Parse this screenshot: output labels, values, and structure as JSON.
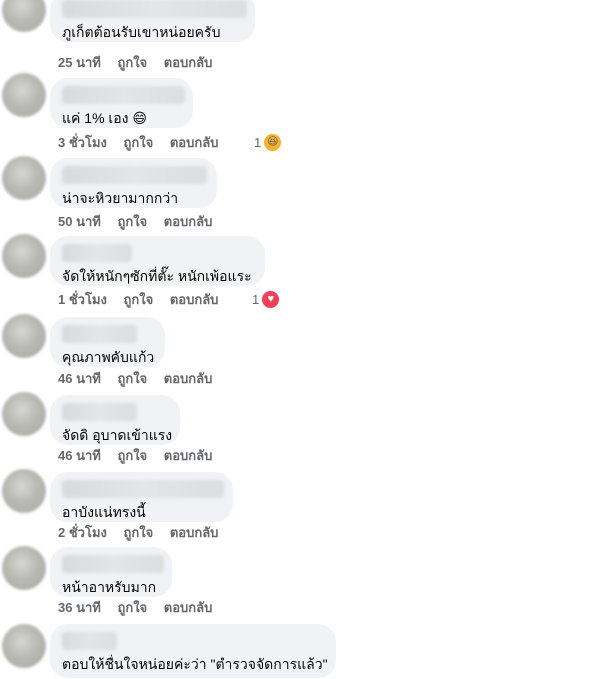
{
  "comments": [
    {
      "text": "ภูเก็ตต้อนรับเขาหน่อยครับ",
      "time": "25 นาที",
      "like": "ถูกใจ",
      "reply": "ตอบกลับ"
    },
    {
      "text": "แค่ 1% เอง 😄",
      "time": "3 ชั่วโมง",
      "like": "ถูกใจ",
      "reply": "ตอบกลับ",
      "reaction": {
        "count": "1",
        "icon": "haha-icon",
        "glyph": "😆"
      }
    },
    {
      "text": "น่าจะหิวยามากกว่า",
      "time": "50 นาที",
      "like": "ถูกใจ",
      "reply": "ตอบกลับ"
    },
    {
      "text": "จัดให้หนักๆซักที่ตั๊ะ หนักเพ้อแระ",
      "time": "1 ชั่วโมง",
      "like": "ถูกใจ",
      "reply": "ตอบกลับ",
      "reaction": {
        "count": "1",
        "icon": "love-icon",
        "glyph": "♥"
      }
    },
    {
      "text": "คุณภาพคับแก้ว",
      "time": "46 นาที",
      "like": "ถูกใจ",
      "reply": "ตอบกลับ"
    },
    {
      "text": "จัดดิ อุบาดเข้าแรง",
      "time": "46 นาที",
      "like": "ถูกใจ",
      "reply": "ตอบกลับ"
    },
    {
      "text": "อาบังแน่ทรงนี้",
      "time": "2 ชั่วโมง",
      "like": "ถูกใจ",
      "reply": "ตอบกลับ"
    },
    {
      "text": "หน้าอาหรับมาก",
      "time": "36 นาที",
      "like": "ถูกใจ",
      "reply": "ตอบกลับ"
    },
    {
      "text": "ตอบให้ชื่นใจหน่อยค่ะว่า \"ตำรวจจัดการแล้ว\"",
      "time": "",
      "like": "",
      "reply": ""
    }
  ]
}
